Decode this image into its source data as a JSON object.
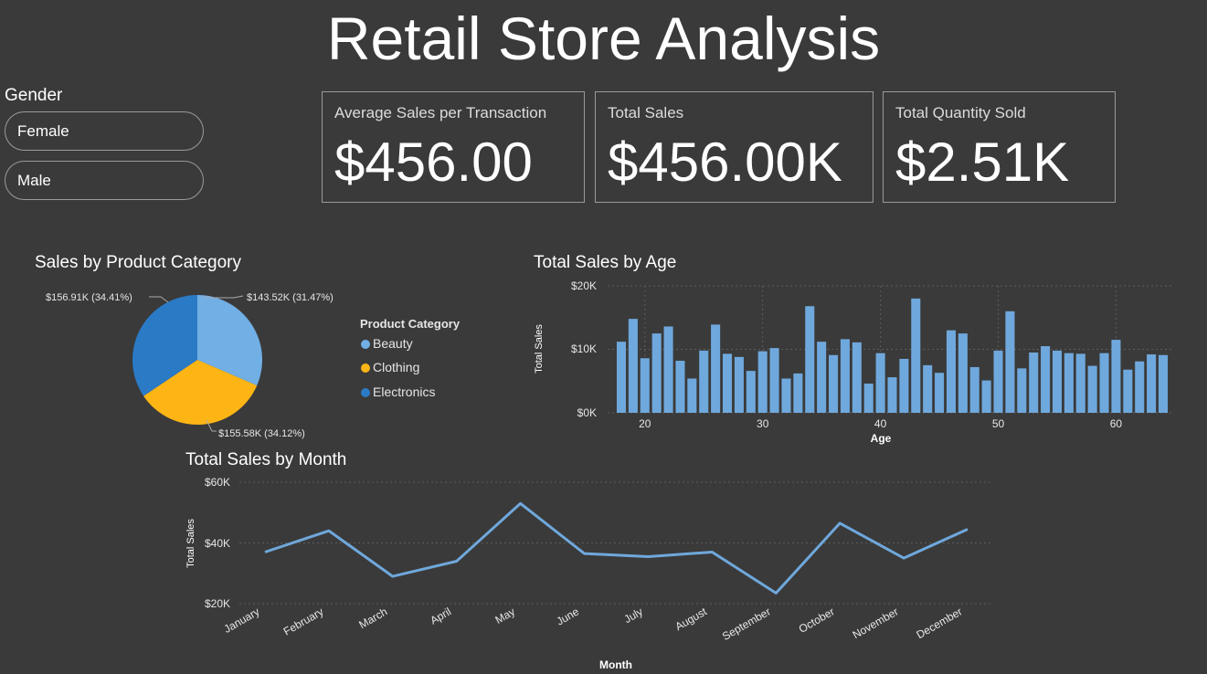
{
  "title": "Retail Store Analysis",
  "slicer": {
    "label": "Gender",
    "options": [
      "Female",
      "Male"
    ]
  },
  "cards": [
    {
      "label": "Average Sales per Transaction",
      "value": "$456.00"
    },
    {
      "label": "Total Sales",
      "value": "$456.00K"
    },
    {
      "label": "Total Quantity Sold",
      "value": "$2.51K"
    }
  ],
  "colors": {
    "background": "#3a3a3a",
    "bar": "#6fa8dc",
    "beauty": "#71afe5",
    "clothing": "#fdb515",
    "electronics": "#2b7ac6",
    "line": "#6fa8dc",
    "grid": "#5c5c5c"
  },
  "chart_data": [
    {
      "type": "pie",
      "title": "Sales by Product Category",
      "legend_title": "Product Category",
      "legend_position": "right",
      "labels": [
        "Beauty",
        "Clothing",
        "Electronics"
      ],
      "values": [
        143.52,
        155.58,
        156.91
      ],
      "unit": "K",
      "data_labels": [
        "$143.52K (31.47%)",
        "$155.58K (34.12%)",
        "$156.91K (34.41%)"
      ]
    },
    {
      "type": "bar",
      "title": "Total Sales by Age",
      "xlabel": "Age",
      "ylabel": "Total Sales",
      "x": [
        18,
        19,
        20,
        21,
        22,
        23,
        24,
        25,
        26,
        27,
        28,
        29,
        30,
        31,
        32,
        33,
        34,
        35,
        36,
        37,
        38,
        39,
        40,
        41,
        42,
        43,
        44,
        45,
        46,
        47,
        48,
        49,
        50,
        51,
        52,
        53,
        54,
        55,
        56,
        57,
        58,
        59,
        60,
        61,
        62,
        63,
        64
      ],
      "values": [
        11200,
        14800,
        8600,
        12500,
        13600,
        8200,
        5400,
        9800,
        13900,
        9300,
        8800,
        6600,
        9700,
        10200,
        5400,
        6200,
        16800,
        11200,
        9100,
        11600,
        11100,
        4600,
        9400,
        5600,
        8500,
        18000,
        7500,
        6300,
        13000,
        12500,
        7200,
        5100,
        9800,
        16000,
        7000,
        9500,
        10500,
        9800,
        9400,
        9300,
        7400,
        9400,
        11500,
        6800,
        8100,
        9200,
        9100
      ],
      "xticks": [
        20,
        30,
        40,
        50,
        60
      ],
      "yticks": [
        "$0K",
        "$10K",
        "$20K"
      ],
      "ylim": [
        0,
        20000
      ],
      "grid": true
    },
    {
      "type": "line",
      "title": "Total Sales by Month",
      "xlabel": "Month",
      "ylabel": "Total Sales",
      "categories": [
        "January",
        "February",
        "March",
        "April",
        "May",
        "June",
        "July",
        "August",
        "September",
        "October",
        "November",
        "December"
      ],
      "values": [
        37000,
        44000,
        29000,
        34000,
        53000,
        36500,
        35500,
        37000,
        23500,
        46500,
        35000,
        44500
      ],
      "yticks": [
        "$20K",
        "$40K",
        "$60K"
      ],
      "ylim": [
        20000,
        60000
      ],
      "grid": true
    }
  ]
}
